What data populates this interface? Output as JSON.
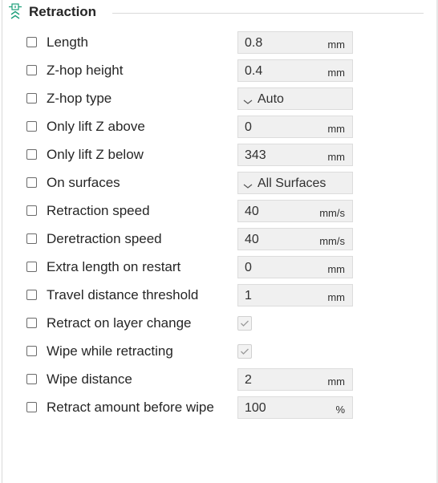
{
  "section": {
    "title": "Retraction",
    "icon": "retraction-icon"
  },
  "rows": [
    {
      "label": "Length",
      "type": "input",
      "value": "0.8",
      "unit": "mm"
    },
    {
      "label": "Z-hop height",
      "type": "input",
      "value": "0.4",
      "unit": "mm"
    },
    {
      "label": "Z-hop type",
      "type": "combo",
      "value": "Auto"
    },
    {
      "label": "Only lift Z above",
      "type": "input",
      "value": "0",
      "unit": "mm"
    },
    {
      "label": "Only lift Z below",
      "type": "input",
      "value": "343",
      "unit": "mm"
    },
    {
      "label": "On surfaces",
      "type": "combo",
      "value": "All Surfaces"
    },
    {
      "label": "Retraction speed",
      "type": "input",
      "value": "40",
      "unit": "mm/s"
    },
    {
      "label": "Deretraction speed",
      "type": "input",
      "value": "40",
      "unit": "mm/s"
    },
    {
      "label": "Extra length on restart",
      "type": "input",
      "value": "0",
      "unit": "mm"
    },
    {
      "label": "Travel distance threshold",
      "type": "input",
      "value": "1",
      "unit": "mm"
    },
    {
      "label": "Retract on layer change",
      "type": "checkbox",
      "checked": true
    },
    {
      "label": "Wipe while retracting",
      "type": "checkbox",
      "checked": true
    },
    {
      "label": "Wipe distance",
      "type": "input",
      "value": "2",
      "unit": "mm"
    },
    {
      "label": "Retract amount before wipe",
      "type": "input",
      "value": "100",
      "unit": "%"
    }
  ]
}
